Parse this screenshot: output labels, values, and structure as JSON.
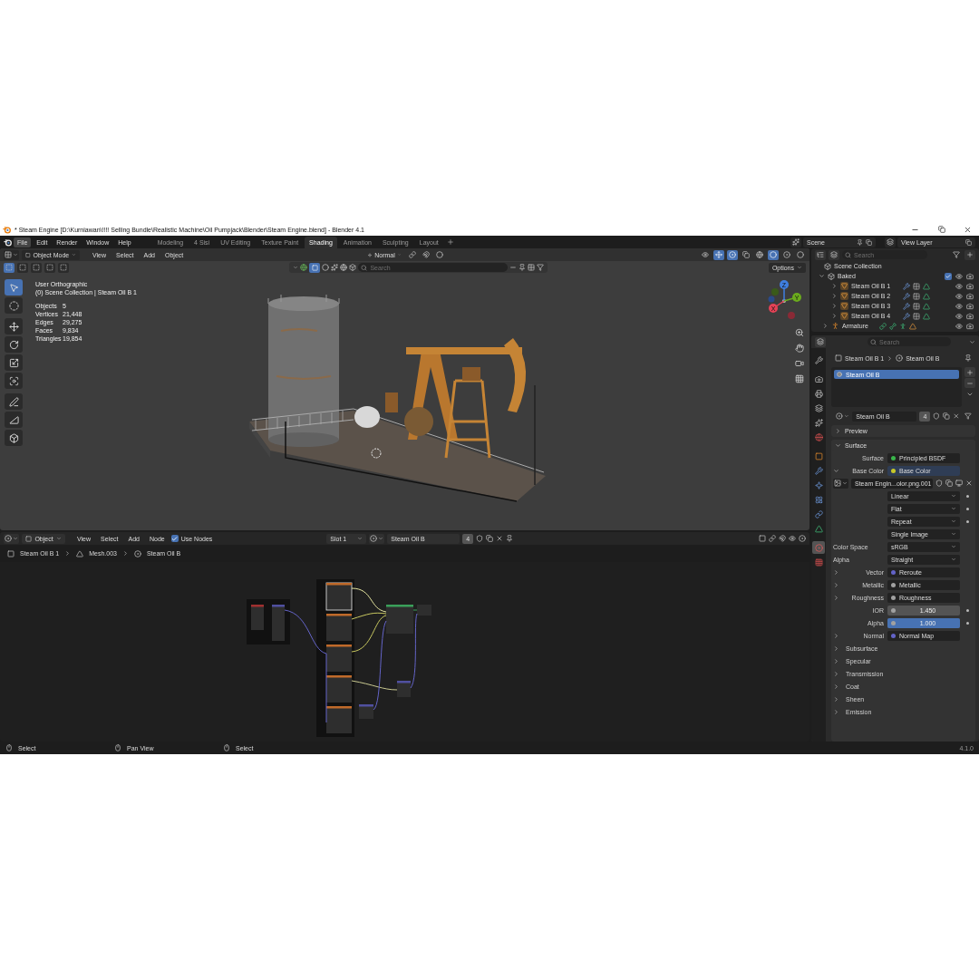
{
  "title_bar": {
    "title": "* Steam Engine [D:\\Kurniawan\\!!!! Selling Bundle\\Realistic Machine\\Oil Pumpjack\\Blender\\Steam Engine.blend] - Blender 4.1"
  },
  "menu": [
    {
      "label": "File",
      "selected": true
    },
    {
      "label": "Edit",
      "selected": false
    },
    {
      "label": "Render",
      "selected": false
    },
    {
      "label": "Window",
      "selected": false
    },
    {
      "label": "Help",
      "selected": false
    }
  ],
  "workspaces": [
    {
      "label": "Modeling",
      "selected": false
    },
    {
      "label": "4 Sisi",
      "selected": false
    },
    {
      "label": "UV Editing",
      "selected": false
    },
    {
      "label": "Texture Paint",
      "selected": false
    },
    {
      "label": "Shading",
      "selected": true
    },
    {
      "label": "Animation",
      "selected": false
    },
    {
      "label": "Sculpting",
      "selected": false
    },
    {
      "label": "Layout",
      "selected": false
    }
  ],
  "scene": "Scene",
  "view_layer": "View Layer",
  "viewport": {
    "mode": "Object Mode",
    "menus": [
      "View",
      "Select",
      "Add",
      "Object"
    ],
    "orientation": "Normal",
    "search": {
      "placeholder": "Search"
    },
    "options": "Options",
    "selection_modes": [
      {
        "selected": true
      },
      {
        "selected": false
      },
      {
        "selected": false
      },
      {
        "selected": false
      },
      {
        "selected": false
      }
    ],
    "tools": [
      {
        "kind": "select",
        "selected": true
      },
      {
        "kind": "cursor",
        "selected": false
      },
      {
        "kind": "move",
        "selected": false
      },
      {
        "kind": "rotate",
        "selected": false
      },
      {
        "kind": "scale",
        "selected": false
      },
      {
        "kind": "transform",
        "selected": false
      },
      {
        "kind": "annotate",
        "selected": false
      },
      {
        "kind": "measure",
        "selected": false
      },
      {
        "kind": "add_cube",
        "selected": false
      }
    ],
    "view": "User Orthographic",
    "context": "(0) Scene Collection | Steam Oil B 1",
    "stats": [
      {
        "label": "Objects",
        "value": "5"
      },
      {
        "label": "Vertices",
        "value": "21,448"
      },
      {
        "label": "Edges",
        "value": "29,275"
      },
      {
        "label": "Faces",
        "value": "9,834"
      },
      {
        "label": "Triangles",
        "value": "19,854"
      }
    ],
    "gizmo": [
      {
        "label": "Z",
        "color": "#3f7fe0"
      },
      {
        "label": "Y",
        "color": "#6bab1d"
      },
      {
        "label": "X",
        "color": "#e54256"
      }
    ]
  },
  "node_editor": {
    "mode": "Object",
    "menus": [
      "View",
      "Select",
      "Add",
      "Node"
    ],
    "use_nodes": {
      "label": "Use Nodes",
      "checked": true
    },
    "slot": "Slot 1",
    "material": "Steam Oil B",
    "users": "4",
    "breadcrumb": [
      "Steam Oil B 1",
      "Mesh.003",
      "Steam Oil B"
    ]
  },
  "outliner": {
    "search": {
      "placeholder": "Search"
    },
    "root": "Scene Collection",
    "collections": [
      {
        "name": "Baked",
        "expanded": true,
        "checked": true,
        "children": [
          {
            "name": "Steam Oil B 1",
            "kind": "mesh",
            "expanded": false,
            "visible": true
          },
          {
            "name": "Steam Oil B 2",
            "kind": "mesh",
            "expanded": false,
            "visible": true
          },
          {
            "name": "Steam Oil B 3",
            "kind": "mesh",
            "expanded": false,
            "visible": true
          },
          {
            "name": "Steam Oil B 4",
            "kind": "mesh",
            "expanded": false,
            "visible": true
          }
        ]
      }
    ],
    "objects": [
      {
        "name": "Armature",
        "kind": "armature",
        "expanded": false,
        "visible": true
      }
    ]
  },
  "properties": {
    "search": {
      "placeholder": "Search"
    },
    "tabs": [
      {
        "kind": "tool",
        "selected": false
      },
      {
        "kind": "render",
        "selected": false
      },
      {
        "kind": "output",
        "selected": false
      },
      {
        "kind": "view_layer",
        "selected": false
      },
      {
        "kind": "scene",
        "selected": false
      },
      {
        "kind": "world",
        "selected": false
      },
      {
        "kind": "object",
        "selected": false
      },
      {
        "kind": "modifiers",
        "selected": false
      },
      {
        "kind": "particles",
        "selected": false
      },
      {
        "kind": "physics",
        "selected": false
      },
      {
        "kind": "constraints",
        "selected": false
      },
      {
        "kind": "data",
        "selected": false
      },
      {
        "kind": "material",
        "selected": true
      },
      {
        "kind": "texture",
        "selected": false
      }
    ],
    "breadcrumb": [
      "Steam Oil B 1",
      "Steam Oil B"
    ],
    "slots": [
      {
        "name": "Steam Oil B",
        "selected": true
      }
    ],
    "material": "Steam Oil B",
    "users": "4",
    "panels": [
      {
        "title": "Preview",
        "expanded": false
      },
      {
        "title": "Surface",
        "expanded": true
      }
    ],
    "rows": [
      {
        "kind": "socket",
        "label": "Surface",
        "value": "Principled BSDF",
        "color": "#39b54a",
        "expandable": false
      },
      {
        "kind": "socket",
        "label": "Base Color",
        "value": "Base Color",
        "color": "#c7c729",
        "expandable": true,
        "expanded": true
      },
      {
        "kind": "image",
        "value": "Steam Engin...olor.png.001"
      },
      {
        "kind": "dropdown",
        "value": "Linear",
        "decorator": true
      },
      {
        "kind": "dropdown",
        "value": "Flat",
        "decorator": true
      },
      {
        "kind": "dropdown",
        "value": "Repeat",
        "decorator": true
      },
      {
        "kind": "dropdown",
        "value": "Single Image",
        "decorator": false
      },
      {
        "kind": "dropdown",
        "label": "Color Space",
        "value": "sRGB",
        "decorator": false
      },
      {
        "kind": "dropdown",
        "label": "Alpha",
        "value": "Straight",
        "decorator": false
      },
      {
        "kind": "socket",
        "label": "Vector",
        "value": "Reroute",
        "color": "#6363c7",
        "expandable": true,
        "expanded": false
      },
      {
        "kind": "socket",
        "label": "Metallic",
        "value": "Metallic",
        "color": "#a1a1a1",
        "expandable": true,
        "expanded": false
      },
      {
        "kind": "socket",
        "label": "Roughness",
        "value": "Roughness",
        "color": "#a1a1a1",
        "expandable": true,
        "expanded": false
      },
      {
        "kind": "number",
        "label": "IOR",
        "value": "1.450",
        "color": "#a1a1a1",
        "decorator": true
      },
      {
        "kind": "slider",
        "label": "Alpha",
        "value": "1.000",
        "level": 1,
        "color": "#a1a1a1",
        "decorator": true
      },
      {
        "kind": "socket",
        "label": "Normal",
        "value": "Normal Map",
        "color": "#6363c7",
        "expandable": true,
        "expanded": false
      },
      {
        "kind": "subpanel",
        "label": "Subsurface",
        "expanded": false
      },
      {
        "kind": "subpanel",
        "label": "Specular",
        "expanded": false
      },
      {
        "kind": "subpanel",
        "label": "Transmission",
        "expanded": false
      },
      {
        "kind": "subpanel",
        "label": "Coat",
        "expanded": false
      },
      {
        "kind": "subpanel",
        "label": "Sheen",
        "expanded": false
      },
      {
        "kind": "subpanel",
        "label": "Emission",
        "expanded": false
      }
    ]
  },
  "status_bar": {
    "hints": [
      "Select",
      "Pan View",
      "Select"
    ],
    "version": "4.1.0"
  }
}
